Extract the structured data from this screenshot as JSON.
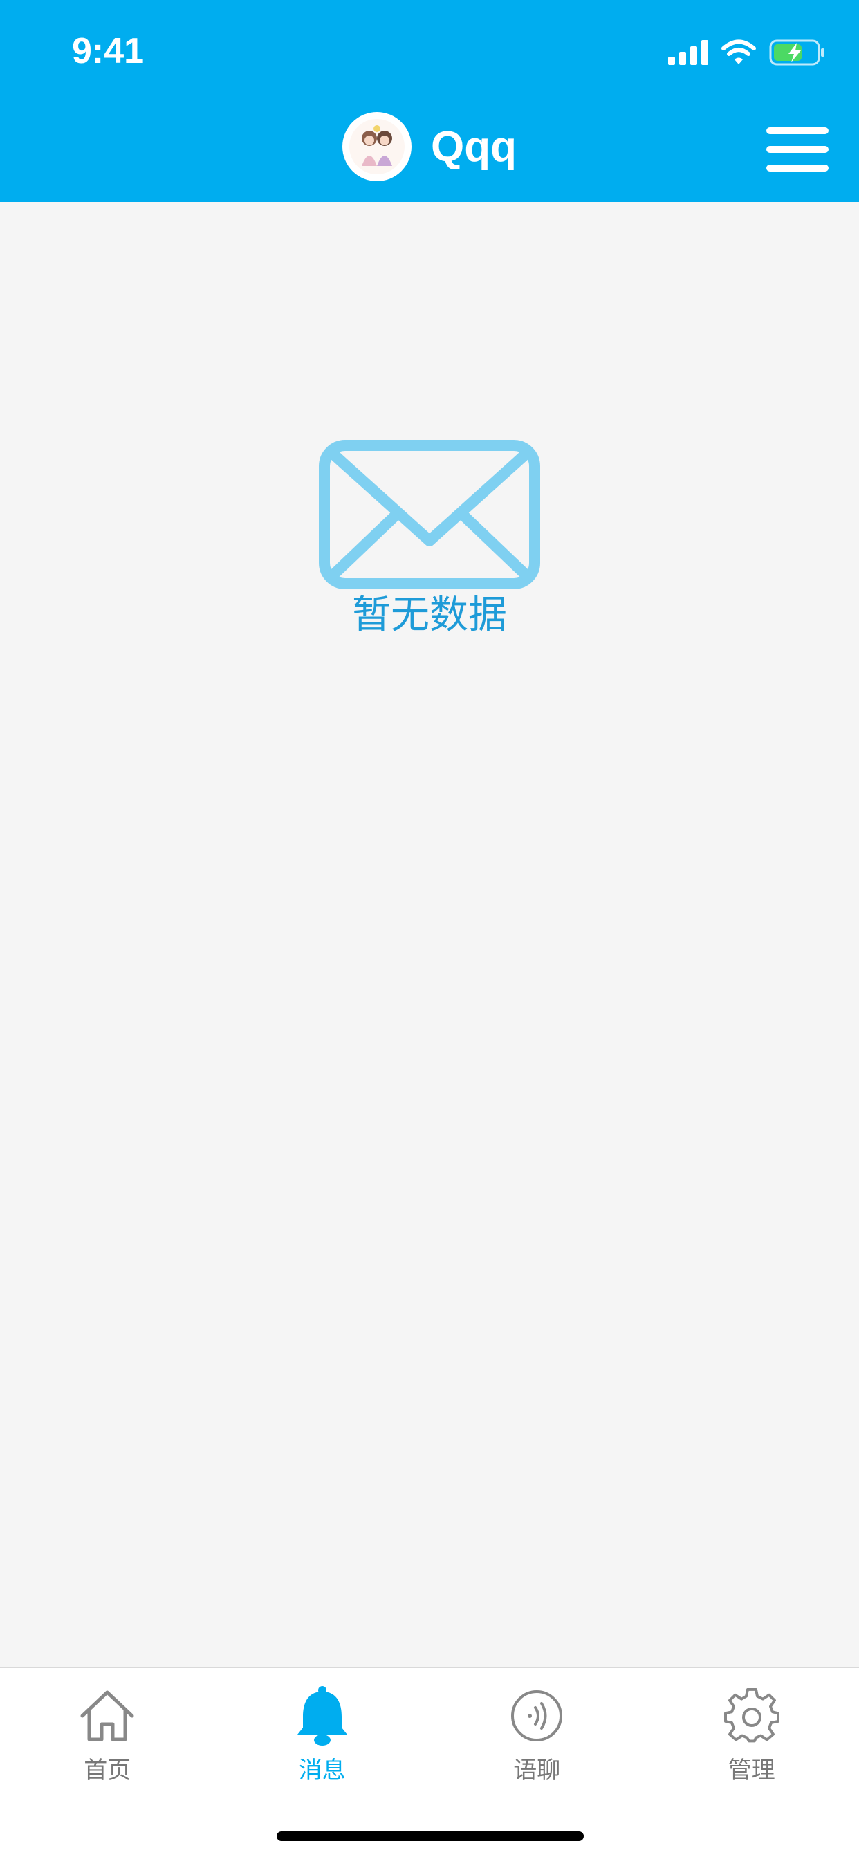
{
  "status_bar": {
    "time": "9:41"
  },
  "header": {
    "title": "Qqq",
    "accent_color": "#00adef"
  },
  "empty_state": {
    "icon": "envelope-icon",
    "message": "暂无数据",
    "color": "#1e9bd8"
  },
  "tabbar": {
    "active_index": 1,
    "items": [
      {
        "label": "首页",
        "icon": "home-icon"
      },
      {
        "label": "消息",
        "icon": "bell-icon"
      },
      {
        "label": "语聊",
        "icon": "voice-icon"
      },
      {
        "label": "管理",
        "icon": "gear-icon"
      }
    ]
  }
}
